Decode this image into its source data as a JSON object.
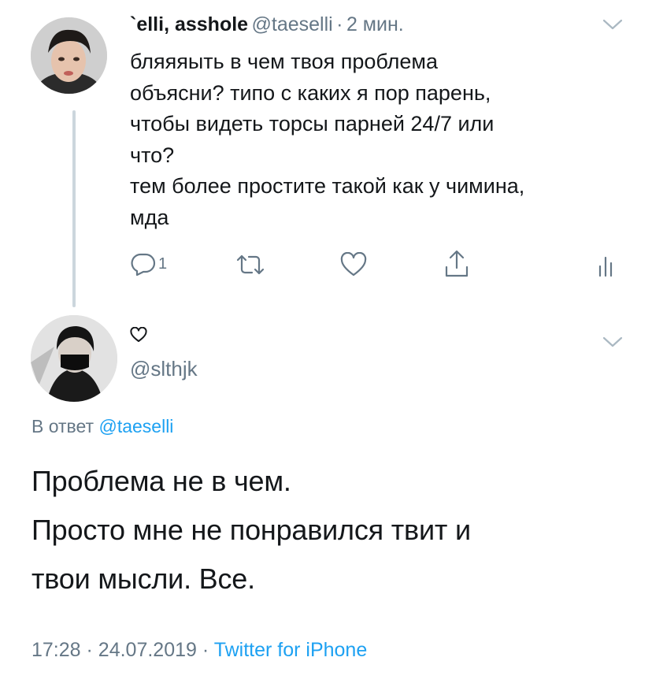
{
  "tweet1": {
    "display_name": "`elli, asshole",
    "handle": "@taeselli",
    "separator": "·",
    "time_ago": "2 мин.",
    "lines": [
      "бляяяыть в чем твоя проблема",
      "объясни? типо с каких я пор парень,",
      "чтобы видеть торсы парней 24/7 или",
      "что?",
      "тем более простите такой как у чимина,",
      "мда"
    ],
    "reply_count": "1",
    "icons": [
      "reply-icon",
      "retweet-icon",
      "like-icon",
      "share-icon",
      "analytics-icon",
      "chevron-down-icon"
    ]
  },
  "tweet2": {
    "display_name_icon": "heart-outline-icon",
    "handle": "@slthjk",
    "reply_prefix": "В ответ",
    "reply_to": "@taeselli",
    "lines": [
      "Проблема не в чем.",
      "Просто мне не понравился твит и",
      "твои мысли. Все."
    ],
    "time": "17:28",
    "sep1": "·",
    "date": "24.07.2019",
    "sep2": "·",
    "source": "Twitter for iPhone"
  },
  "colors": {
    "accent": "#1da1f2",
    "secondary_text": "#657786",
    "primary_text": "#14171a",
    "thread_line": "#ccd6dd"
  }
}
